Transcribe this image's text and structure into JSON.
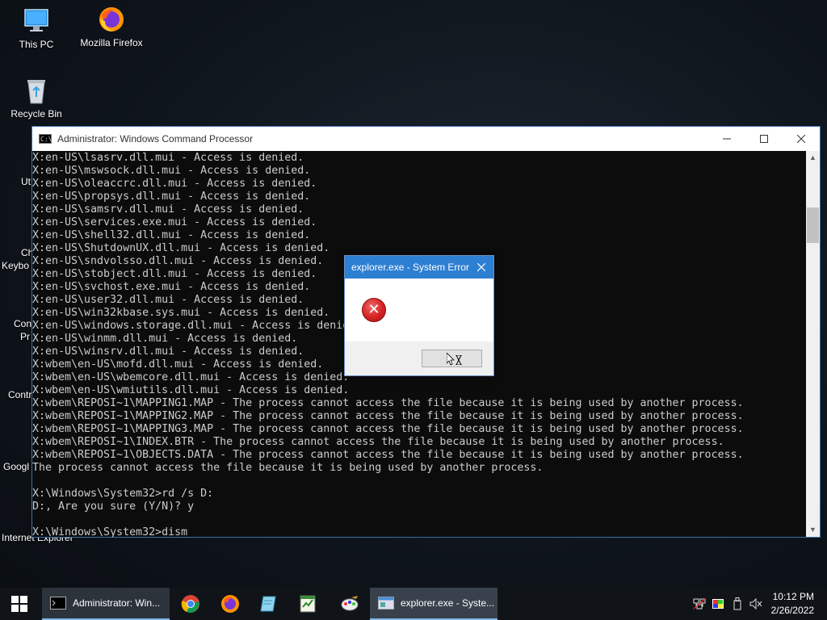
{
  "desktop": {
    "icons": [
      {
        "label": "This PC"
      },
      {
        "label": "Mozilla Firefox"
      },
      {
        "label": "Recycle Bin"
      }
    ],
    "partial_labels": [
      "Ut",
      "Ch",
      "Keybo",
      "Con",
      "Pr",
      "Contr",
      "Googl",
      "Internet Explorer"
    ]
  },
  "cmd_window": {
    "title": "Administrator: Windows Command Processor",
    "lines": [
      "X:en-US\\lsasrv.dll.mui - Access is denied.",
      "X:en-US\\mswsock.dll.mui - Access is denied.",
      "X:en-US\\oleaccrc.dll.mui - Access is denied.",
      "X:en-US\\propsys.dll.mui - Access is denied.",
      "X:en-US\\samsrv.dll.mui - Access is denied.",
      "X:en-US\\services.exe.mui - Access is denied.",
      "X:en-US\\shell32.dll.mui - Access is denied.",
      "X:en-US\\ShutdownUX.dll.mui - Access is denied.",
      "X:en-US\\sndvolsso.dll.mui - Access is denied.",
      "X:en-US\\stobject.dll.mui - Access is denied.",
      "X:en-US\\svchost.exe.mui - Access is denied.",
      "X:en-US\\user32.dll.mui - Access is denied.",
      "X:en-US\\win32kbase.sys.mui - Access is denied.",
      "X:en-US\\windows.storage.dll.mui - Access is denied.",
      "X:en-US\\winmm.dll.mui - Access is denied.",
      "X:en-US\\winsrv.dll.mui - Access is denied.",
      "X:wbem\\en-US\\mofd.dll.mui - Access is denied.",
      "X:wbem\\en-US\\wbemcore.dll.mui - Access is denied.",
      "X:wbem\\en-US\\wmiutils.dll.mui - Access is denied.",
      "X:wbem\\REPOSI~1\\MAPPING1.MAP - The process cannot access the file because it is being used by another process.",
      "X:wbem\\REPOSI~1\\MAPPING2.MAP - The process cannot access the file because it is being used by another process.",
      "X:wbem\\REPOSI~1\\MAPPING3.MAP - The process cannot access the file because it is being used by another process.",
      "X:wbem\\REPOSI~1\\INDEX.BTR - The process cannot access the file because it is being used by another process.",
      "X:wbem\\REPOSI~1\\OBJECTS.DATA - The process cannot access the file because it is being used by another process.",
      "The process cannot access the file because it is being used by another process.",
      "",
      "X:\\Windows\\System32>rd /s D:",
      "D:, Are you sure (Y/N)? y",
      "",
      "X:\\Windows\\System32>dism"
    ]
  },
  "error_dialog": {
    "title": "explorer.exe - System Error",
    "icon": "error-icon",
    "ok_label": ""
  },
  "taskbar": {
    "items": [
      {
        "label": "Administrator: Win..."
      },
      {
        "label": "explorer.exe - Syste..."
      }
    ],
    "pinned": [
      "chrome-icon",
      "firefox-icon",
      "notepad-icon",
      "spreadsheet-icon",
      "paint-icon"
    ],
    "clock": {
      "time": "10:12 PM",
      "date": "2/26/2022"
    }
  },
  "colors": {
    "console_bg": "#0c0c0c",
    "console_fg": "#cccccc",
    "accent": "#2d7fd2",
    "taskbar_bg": "#101418"
  }
}
